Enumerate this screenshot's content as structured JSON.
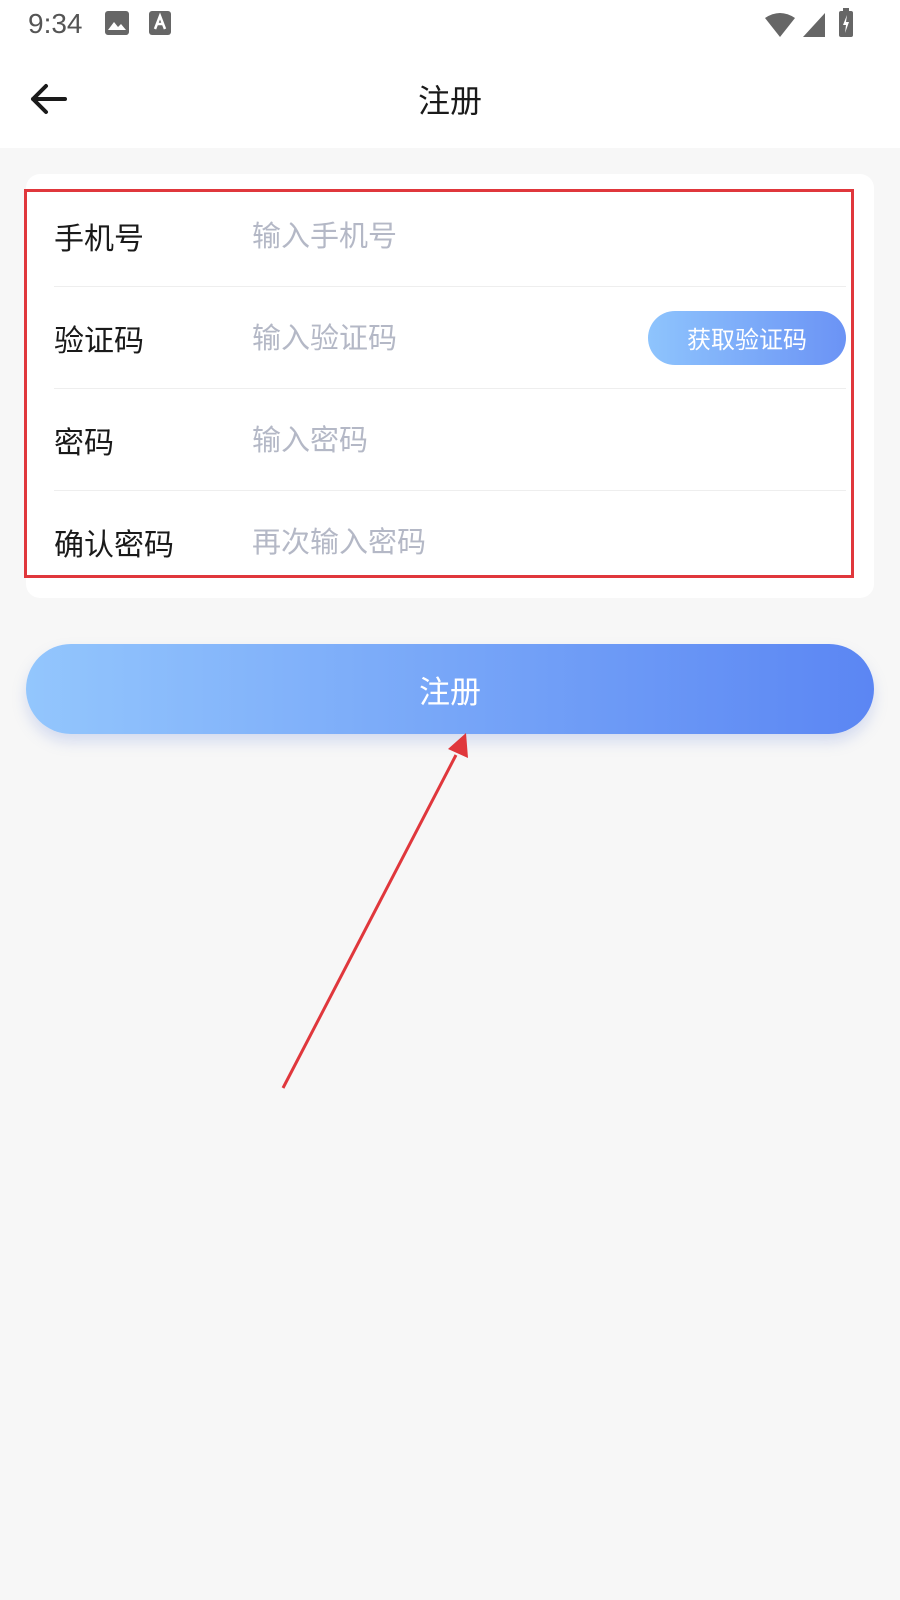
{
  "status_bar": {
    "time": "9:34",
    "icons": [
      "image-icon",
      "text-a-icon",
      "wifi-icon",
      "signal-icon",
      "battery-icon"
    ]
  },
  "header": {
    "title": "注册",
    "back_icon": "arrow-left-icon"
  },
  "form": {
    "phone": {
      "label": "手机号",
      "placeholder": "输入手机号",
      "value": ""
    },
    "code": {
      "label": "验证码",
      "placeholder": "输入验证码",
      "value": "",
      "button_label": "获取验证码"
    },
    "password": {
      "label": "密码",
      "placeholder": "输入密码",
      "value": ""
    },
    "confirm_password": {
      "label": "确认密码",
      "placeholder": "再次输入密码",
      "value": ""
    }
  },
  "submit": {
    "label": "注册"
  },
  "colors": {
    "background": "#f7f7f7",
    "surface": "#ffffff",
    "placeholder": "#b4b8c6",
    "button_gradient_start": "#93c6fd",
    "button_gradient_end": "#5b86f3",
    "annotation": "#e0373c"
  }
}
